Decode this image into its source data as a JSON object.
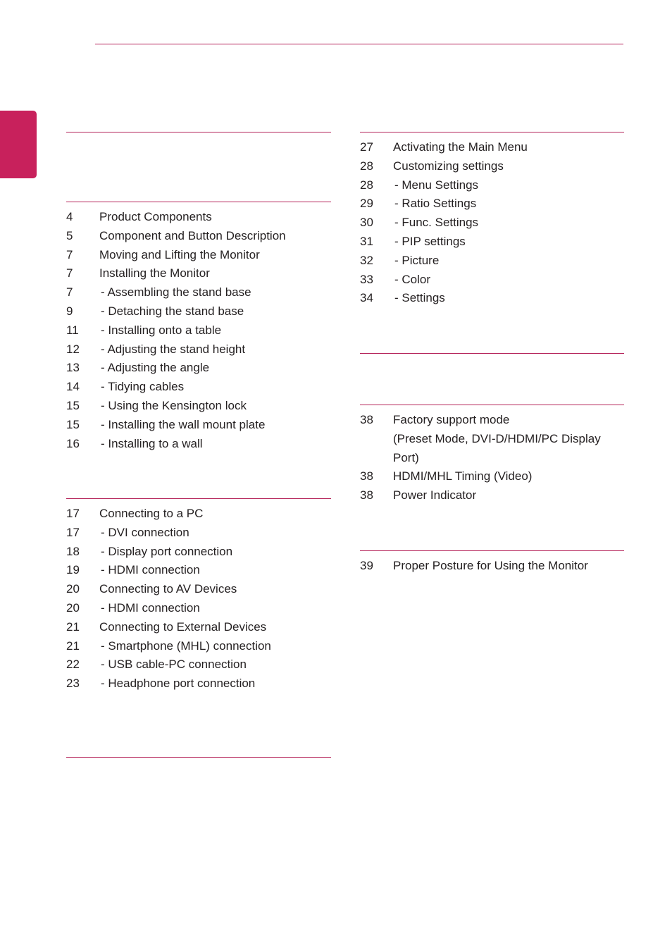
{
  "colors": {
    "accent": "#c8215c",
    "rule": "#b5245a",
    "text": "#231f20"
  },
  "left_column": {
    "sections": [
      {
        "title": "",
        "entries": []
      },
      {
        "title": "",
        "entries": [
          {
            "page": "4",
            "label": "Product Components",
            "sub": false
          },
          {
            "page": "5",
            "label": "Component and Button Description",
            "sub": false
          },
          {
            "page": "7",
            "label": "Moving and Lifting the Monitor",
            "sub": false
          },
          {
            "page": "7",
            "label": "Installing the Monitor",
            "sub": false
          },
          {
            "page": "7",
            "label": "- Assembling the stand base",
            "sub": true
          },
          {
            "page": "9",
            "label": "- Detaching the stand base",
            "sub": true
          },
          {
            "page": "11",
            "label": "- Installing onto a table",
            "sub": true
          },
          {
            "page": "12",
            "label": "- Adjusting the stand height",
            "sub": true
          },
          {
            "page": "13",
            "label": "- Adjusting the angle",
            "sub": true
          },
          {
            "page": "14",
            "label": "- Tidying cables",
            "sub": true
          },
          {
            "page": "15",
            "label": "- Using the Kensington lock",
            "sub": true
          },
          {
            "page": "15",
            "label": "- Installing the wall mount plate",
            "sub": true
          },
          {
            "page": "16",
            "label": "- Installing to a wall",
            "sub": true
          }
        ]
      },
      {
        "title": "",
        "entries": [
          {
            "page": "17",
            "label": "Connecting to a PC",
            "sub": false
          },
          {
            "page": "17",
            "label": "- DVI connection",
            "sub": true
          },
          {
            "page": "18",
            "label": "- Display port connection",
            "sub": true
          },
          {
            "page": "19",
            "label": "- HDMI connection",
            "sub": true
          },
          {
            "page": "20",
            "label": "Connecting to AV Devices",
            "sub": false
          },
          {
            "page": "20",
            "label": "- HDMI connection",
            "sub": true
          },
          {
            "page": "21",
            "label": "Connecting to External Devices",
            "sub": false
          },
          {
            "page": "21",
            "label": "- Smartphone (MHL) connection",
            "sub": true
          },
          {
            "page": "22",
            "label": "- USB cable-PC connection",
            "sub": true
          },
          {
            "page": "23",
            "label": "- Headphone port connection",
            "sub": true
          }
        ]
      },
      {
        "title": "",
        "entries": []
      }
    ]
  },
  "right_column": {
    "sections": [
      {
        "title": "",
        "entries": [
          {
            "page": "27",
            "label": "Activating the Main Menu",
            "sub": false
          },
          {
            "page": "28",
            "label": "Customizing settings",
            "sub": false
          },
          {
            "page": "28",
            "label": "- Menu Settings",
            "sub": true
          },
          {
            "page": "29",
            "label": "- Ratio Settings",
            "sub": true
          },
          {
            "page": "30",
            "label": "- Func. Settings",
            "sub": true
          },
          {
            "page": "31",
            "label": "- PIP settings",
            "sub": true
          },
          {
            "page": "32",
            "label": "- Picture",
            "sub": true
          },
          {
            "page": "33",
            "label": "- Color",
            "sub": true
          },
          {
            "page": "34",
            "label": "- Settings",
            "sub": true
          }
        ]
      },
      {
        "title": "",
        "entries": []
      },
      {
        "title": "",
        "entries": [
          {
            "page": "38",
            "label": "Factory support mode",
            "sub": false
          },
          {
            "page": "",
            "label": "(Preset Mode, DVI-D/HDMI/PC Display Port)",
            "sub": false
          },
          {
            "page": "38",
            "label": "HDMI/MHL Timing (Video)",
            "sub": false
          },
          {
            "page": "38",
            "label": "Power Indicator",
            "sub": false
          }
        ]
      },
      {
        "title": "",
        "entries": [
          {
            "page": "39",
            "label": "Proper Posture for Using the Monitor",
            "sub": false
          }
        ]
      }
    ]
  }
}
